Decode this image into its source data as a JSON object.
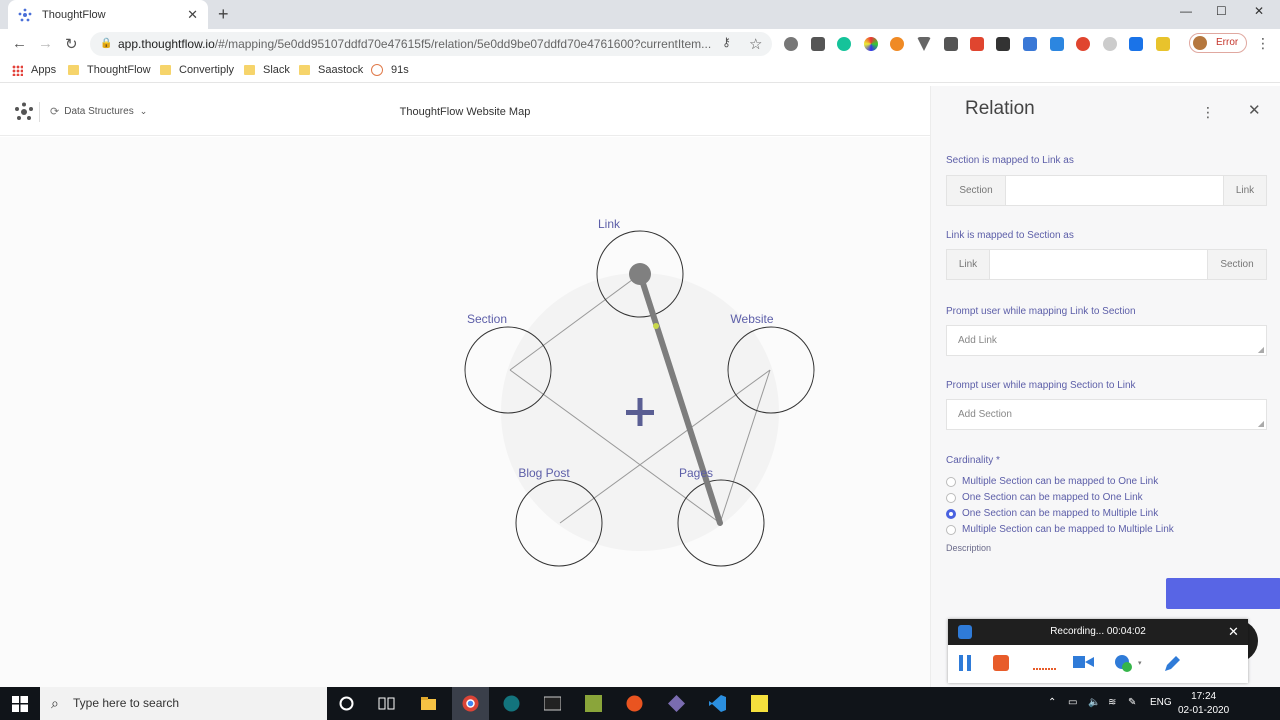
{
  "browser": {
    "tab_title": "ThoughtFlow",
    "url_host": "app.thoughtflow.io",
    "url_path": "/#/mapping/5e0dd95107ddfd70e47615f5/relation/5e0dd9be07ddfd70e4761600?currentItem...",
    "profile_label": "Error",
    "bookmarks": [
      "Apps",
      "ThoughtFlow",
      "Convertiply",
      "Slack",
      "Saastock",
      "91s"
    ]
  },
  "app": {
    "data_structures_label": "Data Structures",
    "map_title": "ThoughtFlow Website Map",
    "nodes": {
      "link": "Link",
      "section": "Section",
      "website": "Website",
      "blog_post": "Blog Post",
      "pages": "Pages"
    }
  },
  "panel": {
    "title": "Relation",
    "section_to_link_label": "Section is mapped to Link as",
    "section_to_link_left": "Section",
    "section_to_link_right": "Link",
    "link_to_section_label": "Link is mapped to Section as",
    "link_to_section_left": "Link",
    "link_to_section_right": "Section",
    "prompt_link_label": "Prompt user while mapping Link to Section",
    "prompt_link_placeholder": "Add Link",
    "prompt_section_label": "Prompt user while mapping Section to Link",
    "prompt_section_placeholder": "Add Section",
    "cardinality_label": "Cardinality *",
    "cardinality_options": [
      "Multiple Section can be mapped to One Link",
      "One Section can be mapped to One Link",
      "One Section can be mapped to Multiple Link",
      "Multiple Section can be mapped to Multiple Link"
    ],
    "cardinality_selected": 2,
    "description_label": "Description"
  },
  "recording": {
    "status": "Recording... 00:04:02"
  },
  "taskbar": {
    "search_placeholder": "Type here to search",
    "language": "ENG",
    "time": "17:24",
    "date": "02-01-2020"
  },
  "colors": {
    "accent": "#5865e5",
    "label_purple": "#5c5ea8",
    "edge_highlight": "#7d7d7d"
  }
}
